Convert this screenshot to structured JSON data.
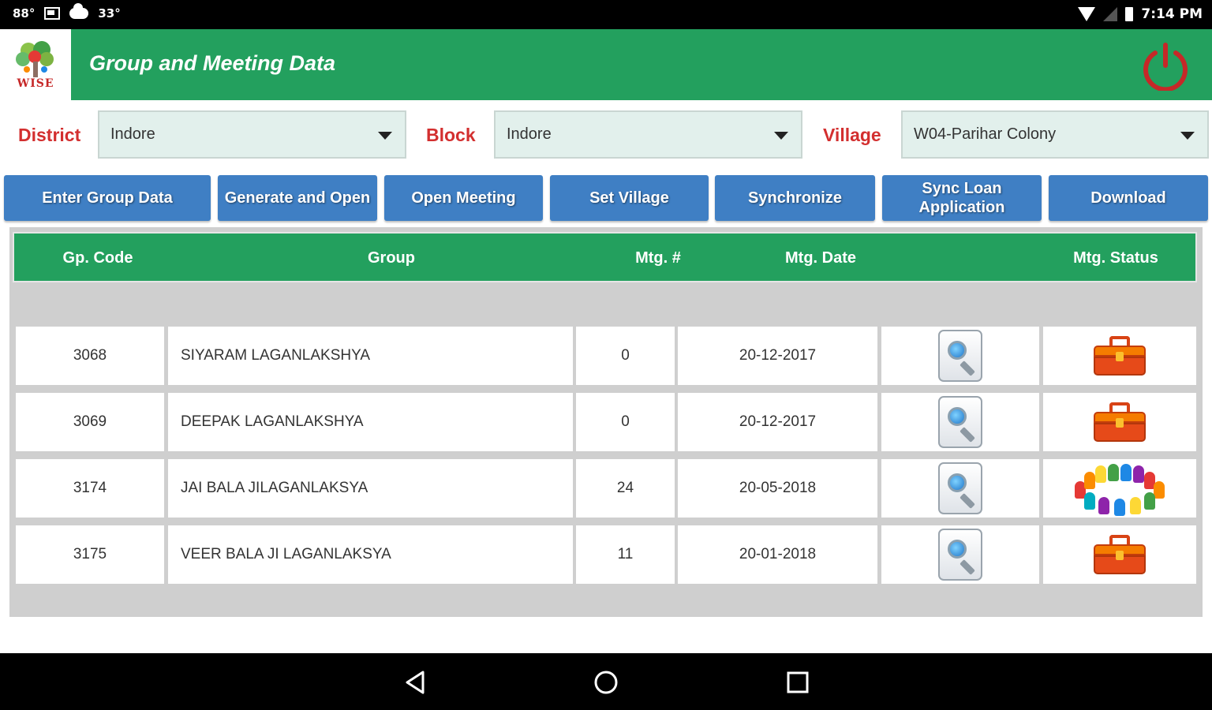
{
  "status_bar": {
    "left_items": [
      "88°",
      "33°"
    ],
    "time": "7:14 PM"
  },
  "app_bar": {
    "logo_text": "WISE",
    "title": "Group and Meeting Data",
    "power_icon": "power-icon",
    "accent_color": "#23a05e"
  },
  "filters": {
    "district_label": "District",
    "district_value": "Indore",
    "block_label": "Block",
    "block_value": "Indore",
    "village_label": "Village",
    "village_value": "W04-Parihar Colony"
  },
  "buttons": {
    "enter_group": "Enter Group Data",
    "generate_open": "Generate and Open",
    "open_meeting": "Open Meeting",
    "set_village": "Set Village",
    "synchronize": "Synchronize",
    "sync_loan_line1": "Sync Loan",
    "sync_loan_line2": "Application",
    "download": "Download"
  },
  "table": {
    "headers": {
      "gp_code": "Gp. Code",
      "group": "Group",
      "mtg_no": "Mtg. #",
      "mtg_date": "Mtg. Date",
      "mtg_status": "Mtg. Status"
    },
    "rows": [
      {
        "gp_code": "3068",
        "group": "SIYARAM LAGANLAKSHYA",
        "mtg_no": "0",
        "mtg_date": "20-12-2017",
        "status_icon": "toolbox-icon"
      },
      {
        "gp_code": "3069",
        "group": "DEEPAK LAGANLAKSHYA",
        "mtg_no": "0",
        "mtg_date": "20-12-2017",
        "status_icon": "toolbox-icon"
      },
      {
        "gp_code": "3174",
        "group": "JAI BALA JILAGANLAKSYA",
        "mtg_no": "24",
        "mtg_date": "20-05-2018",
        "status_icon": "people-circle-icon"
      },
      {
        "gp_code": "3175",
        "group": "VEER BALA JI LAGANLAKSYA",
        "mtg_no": "11",
        "mtg_date": "20-01-2018",
        "status_icon": "toolbox-icon"
      }
    ]
  }
}
